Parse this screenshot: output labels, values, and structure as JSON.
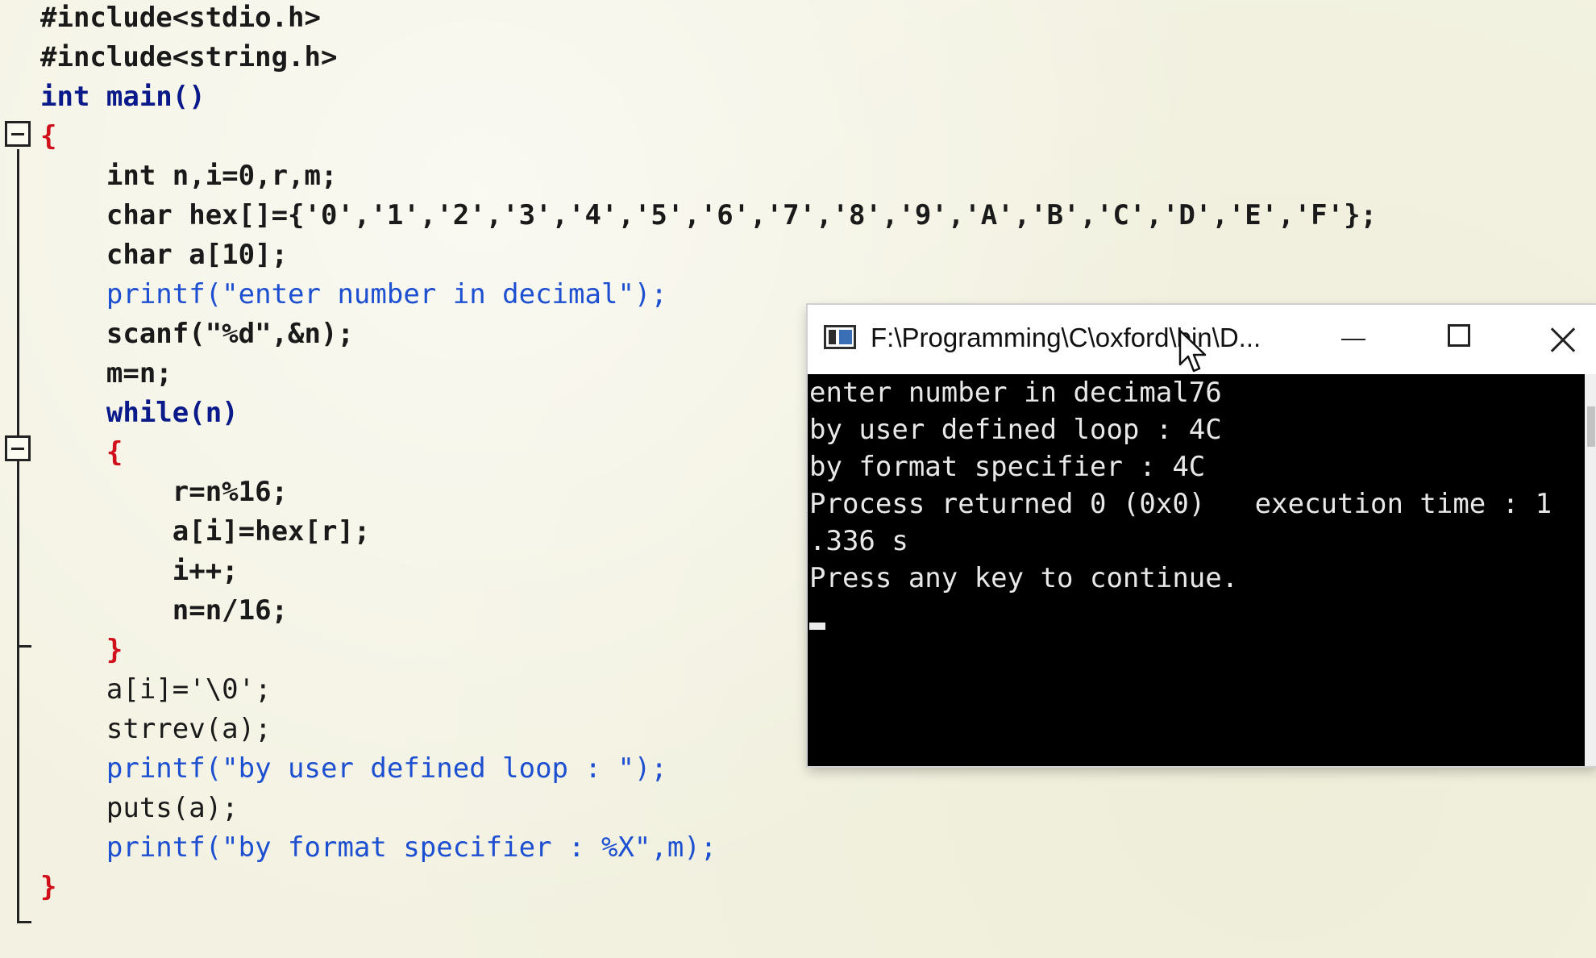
{
  "editor": {
    "lines": [
      "#include<stdio.h>",
      "#include<string.h>",
      "int main()",
      "{",
      "    int n,i=0,r,m;",
      "    char hex[]={'0','1','2','3','4','5','6','7','8','9','A','B','C','D','E','F'};",
      "    char a[10];",
      "    printf(\"enter number in decimal\");",
      "    scanf(\"%d\",&n);",
      "    m=n;",
      "    while(n)",
      "    {",
      "        r=n%16;",
      "        a[i]=hex[r];",
      "        i++;",
      "        n=n/16;",
      "    }",
      "    a[i]='\\0';",
      "    strrev(a);",
      "    printf(\"by user defined loop : \");",
      "    puts(a);",
      "    printf(\"by format specifier : %X\",m);",
      "}"
    ]
  },
  "console": {
    "title": "F:\\Programming\\C\\oxford\\bin\\D...",
    "output_lines": [
      "enter number in decimal76",
      "by user defined loop : 4C",
      "by format specifier : 4C",
      "Process returned 0 (0x0)   execution time : 1",
      ".336 s",
      "Press any key to continue."
    ]
  }
}
